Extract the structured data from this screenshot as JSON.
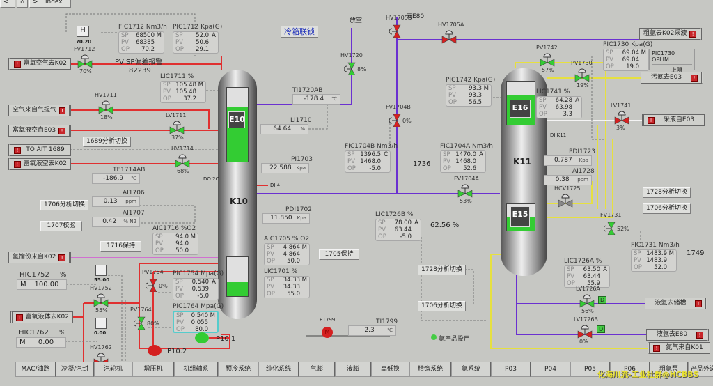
{
  "top": {
    "back": "<",
    "home_icon": "home-icon",
    "forward": ">",
    "index": "index"
  },
  "colors": {
    "red_pipe": "#e03030",
    "purple_pipe": "#6a30d0",
    "yellow_pipe": "#e6e040",
    "valve_open": "#33cc33",
    "valve_closed": "#d82020",
    "alarm": "#c8262a"
  },
  "faceplates": {
    "FIC1712": {
      "title": "FIC1712   Nm3/h",
      "sp": "68500",
      "mode": "M",
      "pv": "68385",
      "op": "70.2"
    },
    "PIC1712": {
      "title": "PIC1712  Kpa(G)",
      "sp": "52.0",
      "mode": "A",
      "pv": "50.6",
      "op": "29.1"
    },
    "LIC1711": {
      "title": "LIC1711        %",
      "sp": "105.48",
      "mode": "M",
      "pv": "105.48",
      "op": "37.2"
    },
    "AIC1716": {
      "title": "AIC1716    %O2",
      "sp": "94.0",
      "mode": "M",
      "pv": "94.0",
      "op": "50.0"
    },
    "PIC1754": {
      "title": "PIC1754 Mpa(G)",
      "sp": "0.540",
      "mode": "A",
      "pv": "0.539",
      "op": "-5.0"
    },
    "PIC1764": {
      "title": "PIC1764 Mpa(G)",
      "sp": "0.540",
      "mode": "M",
      "pv": "0.055",
      "op": "80.0"
    },
    "FIC1704B": {
      "title": "FIC1704B  Nm3/h",
      "sp": "1396.5",
      "mode": "C",
      "pv": "1468.0",
      "op": "-5.0"
    },
    "FIC1704A": {
      "title": "FIC1704A  Nm3/h",
      "sp": "1470.0",
      "mode": "A",
      "pv": "1468.0",
      "op": "52.6"
    },
    "PIC1742": {
      "title": "PIC1742  Kpa(G)",
      "sp": "93.3",
      "mode": "M",
      "pv": "93.3",
      "op": "56.5"
    },
    "PIC1730": {
      "title": "PIC1730  Kpa(G)",
      "sp": "69.04",
      "mode": "M",
      "pv": "69.04",
      "op": "19.0"
    },
    "LIC1741": {
      "title": "LIC1741          %",
      "sp": "64.28",
      "mode": "A",
      "pv": "63.98",
      "op": "3.3"
    },
    "LIC1726B": {
      "title": "LIC1726B          %",
      "sp": "78.00",
      "mode": "A",
      "pv": "63.44",
      "op": "-5.0"
    },
    "AIC1705": {
      "title": "AIC1705    % O2",
      "sp": "4.864",
      "mode": "M",
      "pv": "4.864",
      "op": "50.0"
    },
    "LIC1701": {
      "title": "LIC1701           %",
      "sp": "34.33",
      "mode": "M",
      "pv": "34.33",
      "op": "55.0"
    },
    "LIC1726A": {
      "title": "LIC1726A             %",
      "sp": "63.50",
      "mode": "A",
      "pv": "63.44",
      "op": "55.9"
    },
    "FIC1731": {
      "title": "FIC1731   Nm3/h",
      "sp": "1483.9",
      "mode": "M",
      "pv": "1483.9",
      "op": "52.0"
    }
  },
  "fp_labels": {
    "sp": "SP",
    "pv": "PV",
    "op": "OP"
  },
  "readouts": {
    "TI1720AB": {
      "title": "TI1720AB",
      "value": "-178.4",
      "unit": "℃"
    },
    "LI1710": {
      "title": "LI1710",
      "value": "64.64",
      "unit": "%"
    },
    "PI1703": {
      "title": "PI1703",
      "value": "22.588",
      "unit": "Kpa"
    },
    "TE1714AB": {
      "title": "TE1714AB",
      "value": "-186.9",
      "unit": "℃"
    },
    "AI1706": {
      "title": "AI1706",
      "value": "0.13",
      "unit": "ppm"
    },
    "AI1707": {
      "title": "AI1707",
      "value": "0.42",
      "unit": "% N2"
    },
    "PDI1702": {
      "title": "PDI1702",
      "value": "11.850",
      "unit": "Kpa"
    },
    "TI1799": {
      "title": "TI1799",
      "value": "2.3",
      "unit": "℃"
    },
    "PDI1723": {
      "title": "PDI1723",
      "value": "0.787",
      "unit": "Kpa"
    },
    "AI1728": {
      "title": "AI1728",
      "value": "0.38",
      "unit": "ppm"
    }
  },
  "buttons": {
    "interlock": "冷箱联锁",
    "b1689": "1689分析切换",
    "b1706a": "1706分析切换",
    "b1707": "1707校验",
    "b1716": "1716保持",
    "b1705": "1705保持",
    "b1728a": "1728分析切换",
    "b1706b": "1706分析切换",
    "b1728b": "1728分析切换",
    "b1706c": "1706分析切换"
  },
  "tags": {
    "t1": "富氧空气去K02",
    "t2": "空气来自气提气",
    "t3": "富氧液空自E03",
    "t4": "TO AIT 1689",
    "t5": "富氧液空去K02",
    "t6": "氩馏份来自K02",
    "t7": "富氧液体去K02",
    "t8": "粗氩去K02采液",
    "t9": "污氮去E03",
    "t10": "采液自E03",
    "t11": "液氩去储槽",
    "t12": "液氩去E80",
    "t13": "氮气来自K01"
  },
  "valves": {
    "FV1712": {
      "name": "FV1712",
      "open": "70%",
      "state": "open"
    },
    "HV1711": {
      "name": "HV1711",
      "open": "18%",
      "state": "open"
    },
    "LV1711": {
      "name": "LV1711",
      "open": "37%",
      "state": "open"
    },
    "HV1714": {
      "name": "HV1714",
      "open": "68%",
      "state": "open"
    },
    "HV1720": {
      "name": "HV1720",
      "open": "8%",
      "state": "open"
    },
    "HV1705B": {
      "name": "HV1705B",
      "open": "",
      "state": "closed"
    },
    "HV1705A": {
      "name": "HV1705A",
      "open": "",
      "state": "closed"
    },
    "FV1704B": {
      "name": "FV1704B",
      "open": "0%",
      "state": "closed"
    },
    "FV1704A": {
      "name": "FV1704A",
      "open": "53%",
      "state": "open"
    },
    "PV1742": {
      "name": "PV1742",
      "open": "57%",
      "state": "open"
    },
    "PV1730": {
      "name": "PV1730",
      "open": "19%",
      "state": "open"
    },
    "LV1741": {
      "name": "LV1741",
      "open": "3%",
      "state": "closed"
    },
    "HCV1725": {
      "name": "HCV1725",
      "open": "",
      "state": "manual"
    },
    "FV1731": {
      "name": "FV1731",
      "open": "52%",
      "state": "open"
    },
    "LV1726A": {
      "name": "LV1726A",
      "open": "56%",
      "state": "open"
    },
    "LV1726B": {
      "name": "LV1726B",
      "open": "0%",
      "state": "closed"
    },
    "HV1752": {
      "name": "HV1752",
      "open": "55%",
      "state": "open"
    },
    "PV1754": {
      "name": "PV1754",
      "open": "0%",
      "state": "closed"
    },
    "PV1764": {
      "name": "PV1764",
      "open": "80%",
      "state": "open"
    },
    "HV1762": {
      "name": "HV1762",
      "open": "0%",
      "state": "closed"
    }
  },
  "hic": {
    "HIC1752": {
      "title": "HIC1752",
      "unit": "%",
      "mode": "M",
      "value": "100.00",
      "out": "55.00"
    },
    "HIC1762": {
      "title": "HIC1762",
      "unit": "%",
      "mode": "M",
      "value": "0.00",
      "out": "0.00"
    }
  },
  "h_station": {
    "label": "H",
    "value": "70.20"
  },
  "texts": {
    "pvsp": "PV SP偏差报警",
    "count": "82239",
    "n1736": "1736",
    "lv1726b_pct": "62.56 %",
    "n1749": "1749",
    "toE80": "去E80",
    "vent": "放空",
    "di4": "DI 4",
    "dik11": "DI K11",
    "do2c": "DO 2C",
    "argon": "氩产品投用",
    "e1799": "E1799",
    "motor": "M",
    "p101": "P10.1",
    "p102": "P10.2",
    "oplim_title": "PIC1730  OPLIM",
    "oplim_upper": "上限",
    "d1": "D",
    "d2": "D"
  },
  "columns": {
    "K10": "K10",
    "K11": "K11",
    "E10": "E10",
    "E16": "E16",
    "E15": "E15"
  },
  "column_levels": {
    "E10_pct": 75,
    "K10_bottom_pct": 35,
    "E16_pct": 70,
    "E15_pct": 50
  },
  "nav": [
    "MAC/油路",
    "冷凝/汽封",
    "汽轮机",
    "增压机",
    "机组轴系",
    "预冷系统",
    "纯化系统",
    "气膨",
    "液膨",
    "高低换",
    "精馏系统",
    "氩系统",
    "P03",
    "P04",
    "P05",
    "P06",
    "粗氩泵",
    "产品外送1"
  ],
  "watermark": "化海川流-工业社群@HCBBS"
}
